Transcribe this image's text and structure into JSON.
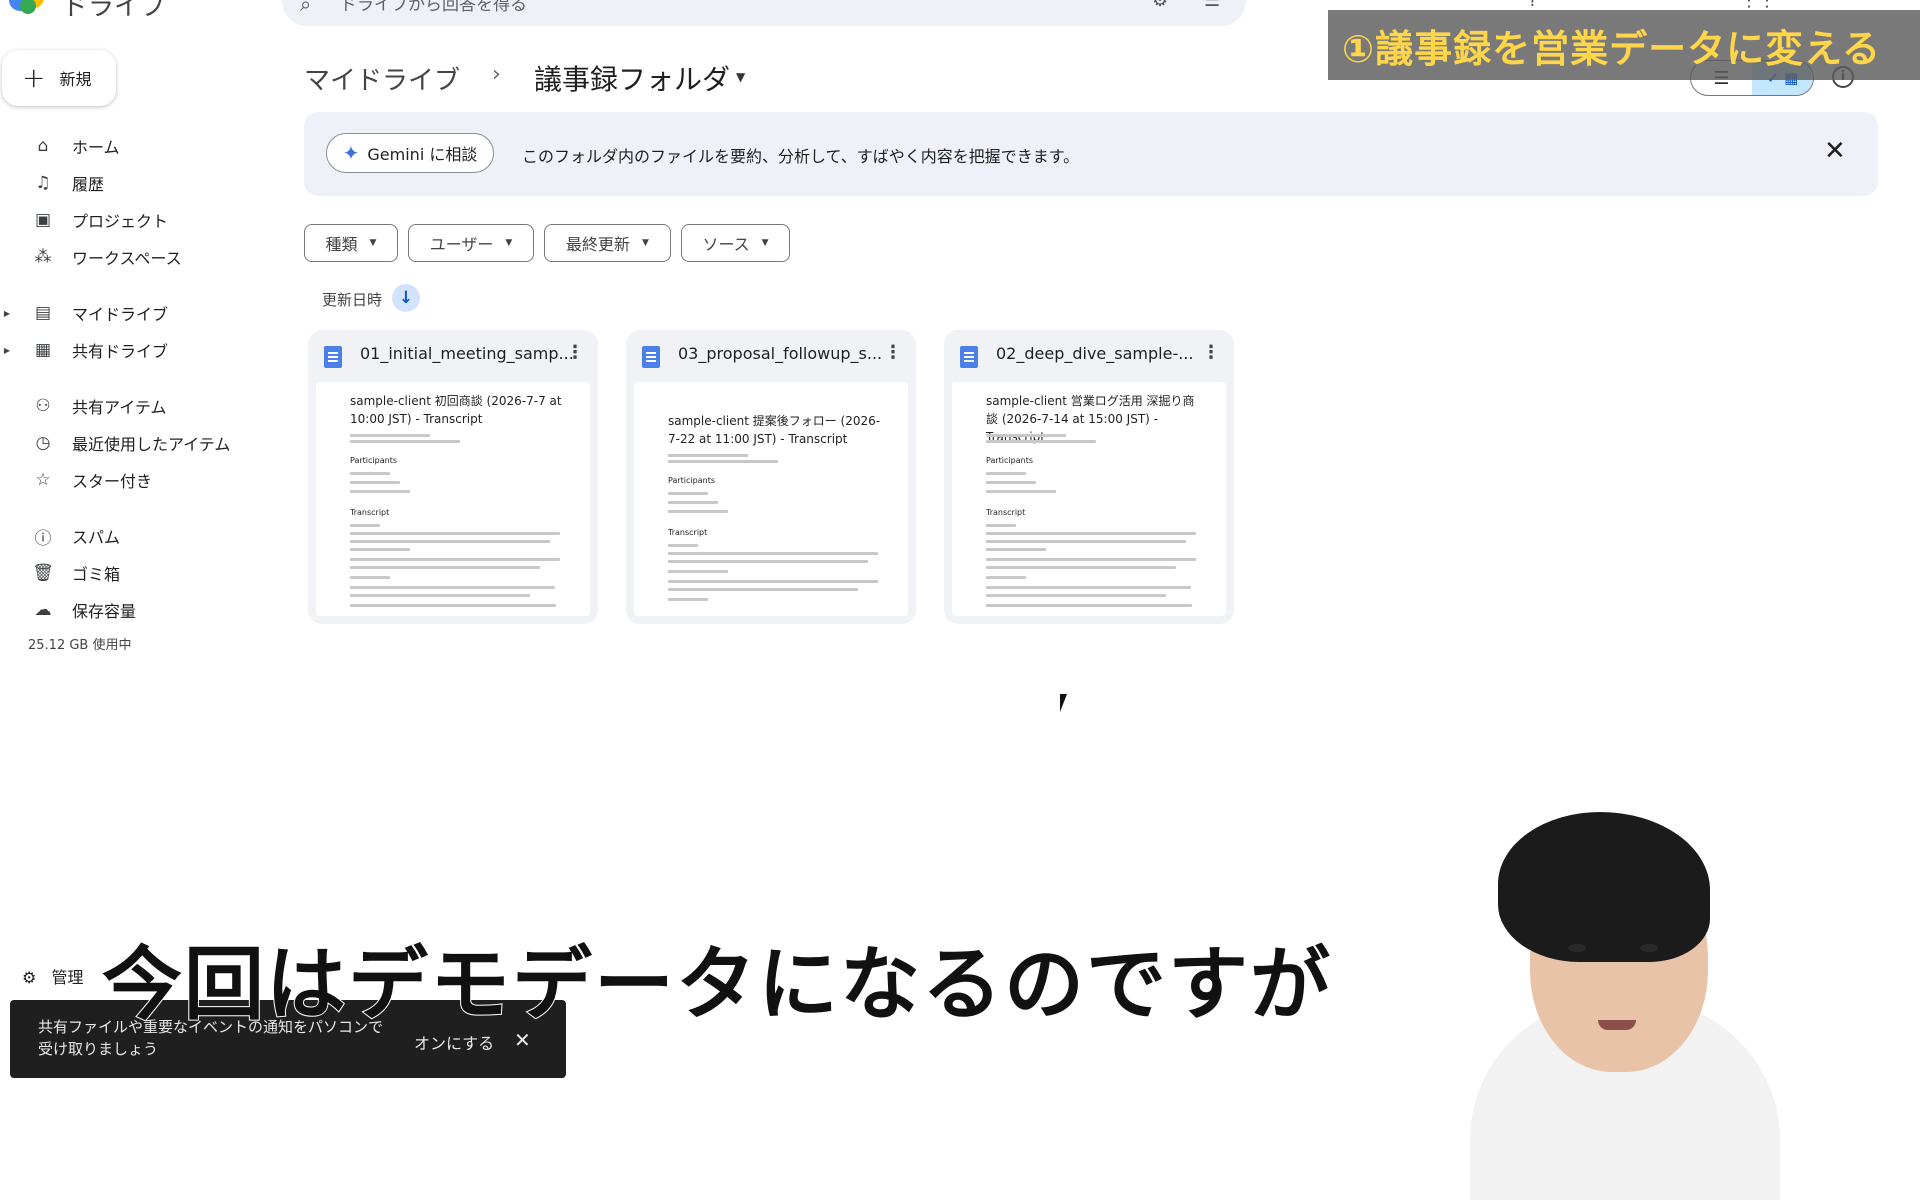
{
  "app": {
    "title": "ドライブ"
  },
  "search": {
    "placeholder": "ドライブから回答を得る"
  },
  "sidebar": {
    "new_label": "新規",
    "items": [
      {
        "label": "ホーム",
        "icon": "home-icon"
      },
      {
        "label": "履歴",
        "icon": "bell-icon"
      },
      {
        "label": "プロジェクト",
        "icon": "project-icon"
      },
      {
        "label": "ワークスペース",
        "icon": "workspace-icon"
      },
      {
        "label": "マイドライブ",
        "icon": "drive-icon"
      },
      {
        "label": "共有ドライブ",
        "icon": "shared-drive-icon"
      },
      {
        "label": "共有アイテム",
        "icon": "people-icon"
      },
      {
        "label": "最近使用したアイテム",
        "icon": "clock-icon"
      },
      {
        "label": "スター付き",
        "icon": "star-icon"
      },
      {
        "label": "スパム",
        "icon": "spam-icon"
      },
      {
        "label": "ゴミ箱",
        "icon": "trash-icon"
      },
      {
        "label": "保存容量",
        "icon": "cloud-icon"
      }
    ],
    "storage_text": "25.12 GB 使用中",
    "admin_label": "管理"
  },
  "breadcrumb": {
    "root": "マイドライブ",
    "separator": "›",
    "current": "議事録フォルダ"
  },
  "banner_overlay": {
    "text": "①議事録を営業データに変える"
  },
  "gemini": {
    "button_label": "Gemini に相談",
    "description": "このフォルダ内のファイルを要約、分析して、すばやく内容を把握できます。"
  },
  "filters": [
    "種類",
    "ユーザー",
    "最終更新",
    "ソース"
  ],
  "sort": {
    "label": "更新日時"
  },
  "files": [
    {
      "name": "01_initial_meeting_samp...",
      "preview_title": "sample-client 初回商談 (2026-7-7 at 10:00 JST) - Transcript",
      "participants_heading": "Participants",
      "transcript_heading": "Transcript"
    },
    {
      "name": "03_proposal_followup_s...",
      "preview_title": "sample-client 提案後フォロー (2026-7-22 at 11:00 JST) - Transcript",
      "participants_heading": "Participants",
      "transcript_heading": "Transcript"
    },
    {
      "name": "02_deep_dive_sample-...",
      "preview_title": "sample-client 営業ログ活用 深掘り商談 (2026-7-14 at 15:00 JST) - Transcript",
      "participants_heading": "Participants",
      "transcript_heading": "Transcript"
    }
  ],
  "caption": {
    "text": "今回はデモデータになるのですが"
  },
  "snackbar": {
    "text": "共有ファイルや重要なイベントの通知をパソコンで受け取りましょう",
    "action": "オンにする"
  },
  "colors": {
    "accent": "#0b57d0",
    "chip_selected": "#c2e7ff",
    "banner_text": "#ffd54a",
    "doc_icon": "#4a80e8"
  }
}
